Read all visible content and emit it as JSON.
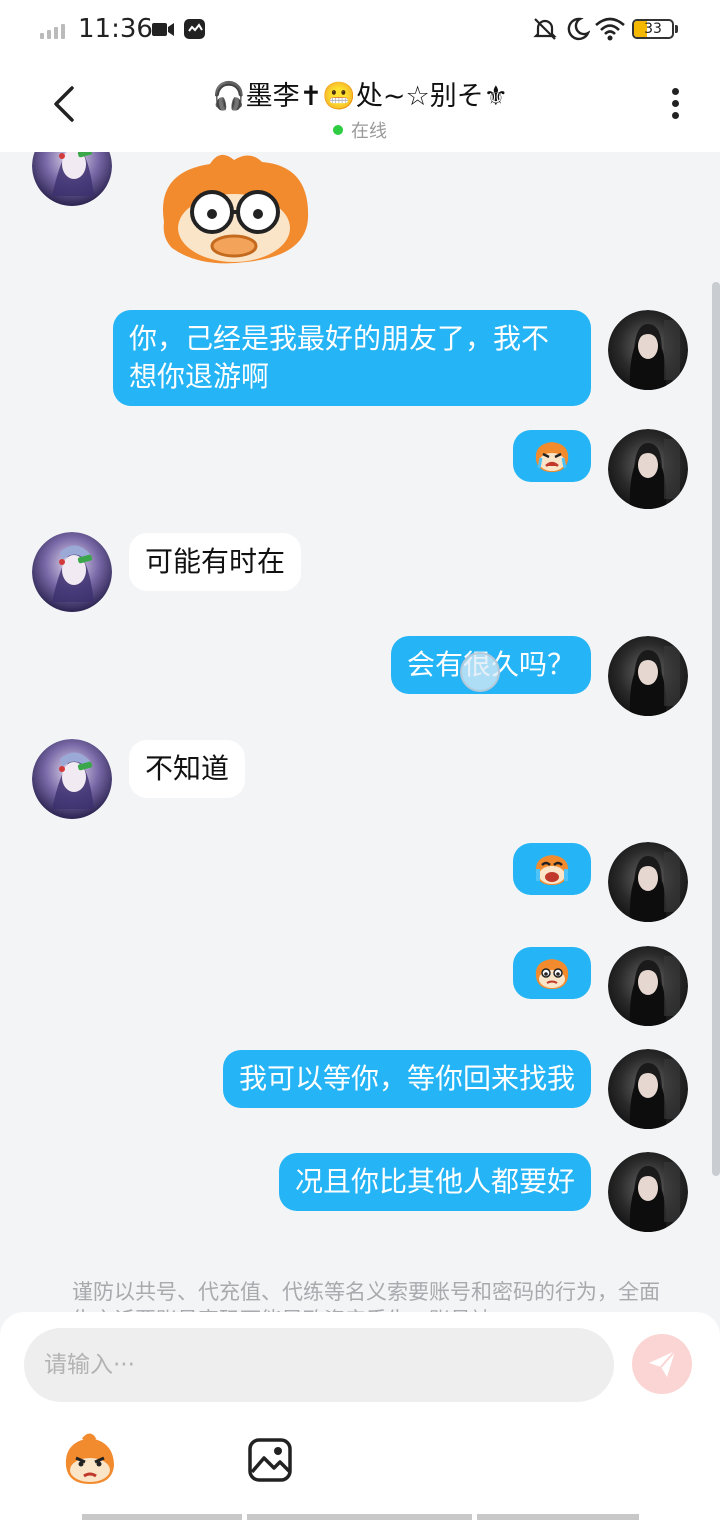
{
  "status_bar": {
    "time": "11:36",
    "battery_level": 33,
    "battery_text": "33",
    "icons": [
      "signal-icon",
      "video-icon",
      "app-notification-icon",
      "mute-icon",
      "moon-icon",
      "wifi-icon",
      "battery-icon"
    ]
  },
  "header": {
    "title": "🎧墨李✝😬处~☆别そ⚜",
    "presence": "在线",
    "presence_color": "#2ecc40"
  },
  "messages": [
    {
      "from": "them",
      "type": "sticker",
      "sticker": "cartoon-face-sticker"
    },
    {
      "from": "me",
      "type": "text",
      "text": "你，己经是我最好的朋友了，我不想你退游啊"
    },
    {
      "from": "me",
      "type": "emoji",
      "emoji": "crying-face-emoji"
    },
    {
      "from": "them",
      "type": "text",
      "text": "可能有时在"
    },
    {
      "from": "me",
      "type": "text",
      "text": "会有很久吗？"
    },
    {
      "from": "them",
      "type": "text",
      "text": "不知道"
    },
    {
      "from": "me",
      "type": "emoji",
      "emoji": "wailing-face-emoji"
    },
    {
      "from": "me",
      "type": "emoji",
      "emoji": "teary-face-emoji"
    },
    {
      "from": "me",
      "type": "text",
      "text": "我可以等你，等你回来找我"
    },
    {
      "from": "me",
      "type": "text",
      "text": "况且你比其他人都要好"
    }
  ],
  "notice": "谨防以共号、代充值、代练等名义索要账号和密码的行为，全面告之诉要账号密码可能导致资产丢失，账号被",
  "input": {
    "placeholder": "请输入···",
    "value": ""
  },
  "toolbar": {
    "emoji_icon": "emoji-sticker-icon",
    "image_icon": "image-icon",
    "send_icon": "send-icon"
  },
  "colors": {
    "my_bubble": "#25b4f5",
    "their_bubble": "#ffffff",
    "background": "#f2f4f6",
    "send_button": "#fbd5d3"
  }
}
